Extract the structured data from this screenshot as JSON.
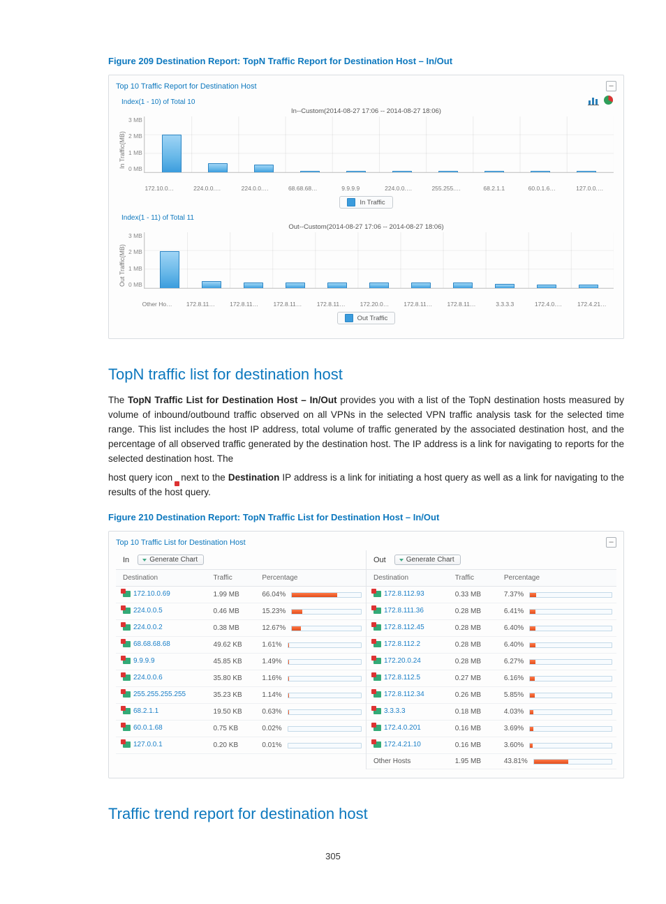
{
  "figure209": {
    "caption": "Figure 209 Destination Report: TopN Traffic Report for Destination Host – In/Out",
    "panel_title": "Top 10 Traffic Report for Destination Host",
    "chart_in": {
      "index_label": "Index(1 - 10) of Total 10",
      "title": "In--Custom(2014-08-27 17:06 -- 2014-08-27 18:06)",
      "ylabel": "In Traffic(MB)",
      "yticks": [
        "3 MB",
        "2 MB",
        "1 MB",
        "0 MB"
      ],
      "legend": "In Traffic"
    },
    "chart_out": {
      "index_label": "Index(1 - 11) of Total 11",
      "title": "Out--Custom(2014-08-27 17:06 -- 2014-08-27 18:06)",
      "ylabel": "Out Traffic(MB)",
      "yticks": [
        "3 MB",
        "2 MB",
        "1 MB",
        "0 MB"
      ],
      "legend": "Out Traffic"
    }
  },
  "section1": {
    "heading": "TopN traffic list for destination host",
    "para1_a": "The ",
    "para1_b_bold": "TopN Traffic List for Destination Host – In/Out",
    "para1_c": " provides you with a list of the TopN destination hosts measured by volume of inbound/outbound traffic observed on all VPNs in the selected VPN traffic analysis task for the selected time range. This list includes the host IP address, total volume of traffic generated by the associated destination host, and the percentage of all observed traffic generated by the destination host. The IP address is a link for navigating to reports for the selected destination host. The",
    "para2_a": "host query icon ",
    "para2_b": " next to the ",
    "para2_b_bold": "Destination",
    "para2_c": " IP address is a link for initiating a host query as well as a link for navigating to the results of the host query."
  },
  "figure210": {
    "caption": "Figure 210 Destination Report: TopN Traffic List for Destination Host – In/Out",
    "panel_title": "Top 10 Traffic List for Destination Host",
    "btn_label": "Generate Chart",
    "col_dest": "Destination",
    "col_traffic": "Traffic",
    "col_pct": "Percentage",
    "tab_in": "In",
    "tab_out": "Out",
    "in_rows": [
      {
        "ip": "172.10.0.69",
        "traffic": "1.99 MB",
        "pct": "66.04%",
        "fill": 66.04
      },
      {
        "ip": "224.0.0.5",
        "traffic": "0.46 MB",
        "pct": "15.23%",
        "fill": 15.23
      },
      {
        "ip": "224.0.0.2",
        "traffic": "0.38 MB",
        "pct": "12.67%",
        "fill": 12.67
      },
      {
        "ip": "68.68.68.68",
        "traffic": "49.62 KB",
        "pct": "1.61%",
        "fill": 1.61
      },
      {
        "ip": "9.9.9.9",
        "traffic": "45.85 KB",
        "pct": "1.49%",
        "fill": 1.49
      },
      {
        "ip": "224.0.0.6",
        "traffic": "35.80 KB",
        "pct": "1.16%",
        "fill": 1.16
      },
      {
        "ip": "255.255.255.255",
        "traffic": "35.23 KB",
        "pct": "1.14%",
        "fill": 1.14
      },
      {
        "ip": "68.2.1.1",
        "traffic": "19.50 KB",
        "pct": "0.63%",
        "fill": 0.63
      },
      {
        "ip": "60.0.1.68",
        "traffic": "0.75 KB",
        "pct": "0.02%",
        "fill": 0.02
      },
      {
        "ip": "127.0.0.1",
        "traffic": "0.20 KB",
        "pct": "0.01%",
        "fill": 0.01
      }
    ],
    "out_rows": [
      {
        "ip": "172.8.112.93",
        "traffic": "0.33 MB",
        "pct": "7.37%",
        "fill": 7.37
      },
      {
        "ip": "172.8.111.36",
        "traffic": "0.28 MB",
        "pct": "6.41%",
        "fill": 6.41
      },
      {
        "ip": "172.8.112.45",
        "traffic": "0.28 MB",
        "pct": "6.40%",
        "fill": 6.4
      },
      {
        "ip": "172.8.112.2",
        "traffic": "0.28 MB",
        "pct": "6.40%",
        "fill": 6.4
      },
      {
        "ip": "172.20.0.24",
        "traffic": "0.28 MB",
        "pct": "6.27%",
        "fill": 6.27
      },
      {
        "ip": "172.8.112.5",
        "traffic": "0.27 MB",
        "pct": "6.16%",
        "fill": 6.16
      },
      {
        "ip": "172.8.112.34",
        "traffic": "0.26 MB",
        "pct": "5.85%",
        "fill": 5.85
      },
      {
        "ip": "3.3.3.3",
        "traffic": "0.18 MB",
        "pct": "4.03%",
        "fill": 4.03
      },
      {
        "ip": "172.4.0.201",
        "traffic": "0.16 MB",
        "pct": "3.69%",
        "fill": 3.69
      },
      {
        "ip": "172.4.21.10",
        "traffic": "0.16 MB",
        "pct": "3.60%",
        "fill": 3.6
      }
    ],
    "out_footer": {
      "label": "Other Hosts",
      "traffic": "1.95 MB",
      "pct": "43.81%",
      "fill": 43.81
    }
  },
  "section2": {
    "heading": "Traffic trend report for destination host"
  },
  "page_number": "305",
  "chart_data": [
    {
      "type": "bar",
      "title": "In--Custom(2014-08-27 17:06 -- 2014-08-27 18:06)",
      "ylabel": "In Traffic(MB)",
      "ylim": [
        0,
        3
      ],
      "categories": [
        "172.10.0…",
        "224.0.0.…",
        "224.0.0.…",
        "68.68.68…",
        "9.9.9.9",
        "224.0.0.…",
        "255.255.…",
        "68.2.1.1",
        "60.0.1.6…",
        "127.0.0.…"
      ],
      "values": [
        1.99,
        0.46,
        0.38,
        0.05,
        0.045,
        0.035,
        0.035,
        0.02,
        0.001,
        0.0002
      ]
    },
    {
      "type": "bar",
      "title": "Out--Custom(2014-08-27 17:06 -- 2014-08-27 18:06)",
      "ylabel": "Out Traffic(MB)",
      "ylim": [
        0,
        3
      ],
      "categories": [
        "Other Ho…",
        "172.8.11…",
        "172.8.11…",
        "172.8.11…",
        "172.8.11…",
        "172.20.0…",
        "172.8.11…",
        "172.8.11…",
        "3.3.3.3",
        "172.4.0.…",
        "172.4.21…"
      ],
      "values": [
        1.95,
        0.33,
        0.28,
        0.28,
        0.28,
        0.28,
        0.27,
        0.26,
        0.18,
        0.16,
        0.16
      ]
    }
  ]
}
